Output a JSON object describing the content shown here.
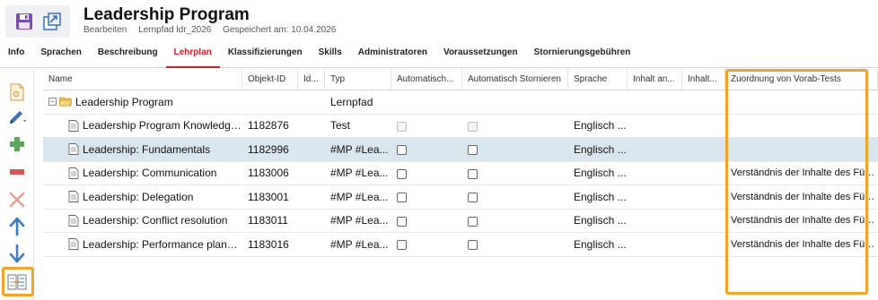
{
  "header": {
    "title": "Leadership Program",
    "meta": [
      "Bearbeiten",
      "Lernpfad ldr_2026",
      "Gespeichert am: 10.04.2026"
    ],
    "icons": [
      "save-icon",
      "export-icon"
    ]
  },
  "tabs": [
    {
      "label": "Info",
      "active": false
    },
    {
      "label": "Sprachen",
      "active": false
    },
    {
      "label": "Beschreibung",
      "active": false
    },
    {
      "label": "Lehrplan",
      "active": true
    },
    {
      "label": "Klassifizierungen",
      "active": false
    },
    {
      "label": "Skills",
      "active": false
    },
    {
      "label": "Administratoren",
      "active": false
    },
    {
      "label": "Voraussetzungen",
      "active": false
    },
    {
      "label": "Stornierungsgebühren",
      "active": false
    }
  ],
  "toolbar": {
    "items": [
      "new-document-icon",
      "edit-pencil-icon",
      "add-plus-icon",
      "remove-minus-icon",
      "delete-x-icon",
      "move-up-arrow-icon",
      "move-down-arrow-icon",
      "assign-tree-icon"
    ],
    "colors": {
      "edit": "#3a6fb5",
      "add": "#5aa95a",
      "remove": "#d9534f",
      "delete": "#e8a08e",
      "arrows": "#3a7cc4",
      "highlight": "#f0a52a"
    }
  },
  "grid": {
    "columns": [
      "Name",
      "Objekt-ID",
      "Id...",
      "Typ",
      "Automatisch...",
      "Automatisch Stornieren",
      "Sprache",
      "Inhalt an...",
      "Inhalt...",
      "Zuordnung von Vorab-Tests"
    ],
    "rows": [
      {
        "name": "Leadership Program",
        "objekt_id": "",
        "id": "",
        "typ": "Lernpfad",
        "auto1": "none",
        "auto2": "none",
        "sprache": "",
        "zuordnung": "",
        "level": 0,
        "selected": false
      },
      {
        "name": "Leadership Program Knowledge ...",
        "objekt_id": "1182876",
        "id": "",
        "typ": "Test",
        "auto1": "disabled",
        "auto2": "disabled",
        "sprache": "Englisch ...",
        "zuordnung": "",
        "level": 1,
        "selected": false
      },
      {
        "name": "Leadership: Fundamentals",
        "objekt_id": "1182996",
        "id": "",
        "typ": "#MP #Lea...",
        "auto1": "enabled",
        "auto2": "enabled",
        "sprache": "Englisch ...",
        "zuordnung": "",
        "level": 1,
        "selected": true
      },
      {
        "name": "Leadership: Communication",
        "objekt_id": "1183006",
        "id": "",
        "typ": "#MP #Lea...",
        "auto1": "enabled",
        "auto2": "enabled",
        "sprache": "Englisch ...",
        "zuordnung": "Verständnis der Inhalte des Führu",
        "level": 1,
        "selected": false
      },
      {
        "name": "Leadership: Delegation",
        "objekt_id": "1183001",
        "id": "",
        "typ": "#MP #Lea...",
        "auto1": "enabled",
        "auto2": "enabled",
        "sprache": "Englisch ...",
        "zuordnung": "Verständnis der Inhalte des Führu",
        "level": 1,
        "selected": false
      },
      {
        "name": "Leadership: Conflict resolution",
        "objekt_id": "1183011",
        "id": "",
        "typ": "#MP #Lea...",
        "auto1": "enabled",
        "auto2": "enabled",
        "sprache": "Englisch ...",
        "zuordnung": "Verständnis der Inhalte des Führu",
        "level": 1,
        "selected": false
      },
      {
        "name": "Leadership: Performance planni...",
        "objekt_id": "1183016",
        "id": "",
        "typ": "#MP #Lea...",
        "auto1": "enabled",
        "auto2": "enabled",
        "sprache": "Englisch ...",
        "zuordnung": "Verständnis der Inhalte des Führu",
        "level": 1,
        "selected": false
      }
    ]
  }
}
